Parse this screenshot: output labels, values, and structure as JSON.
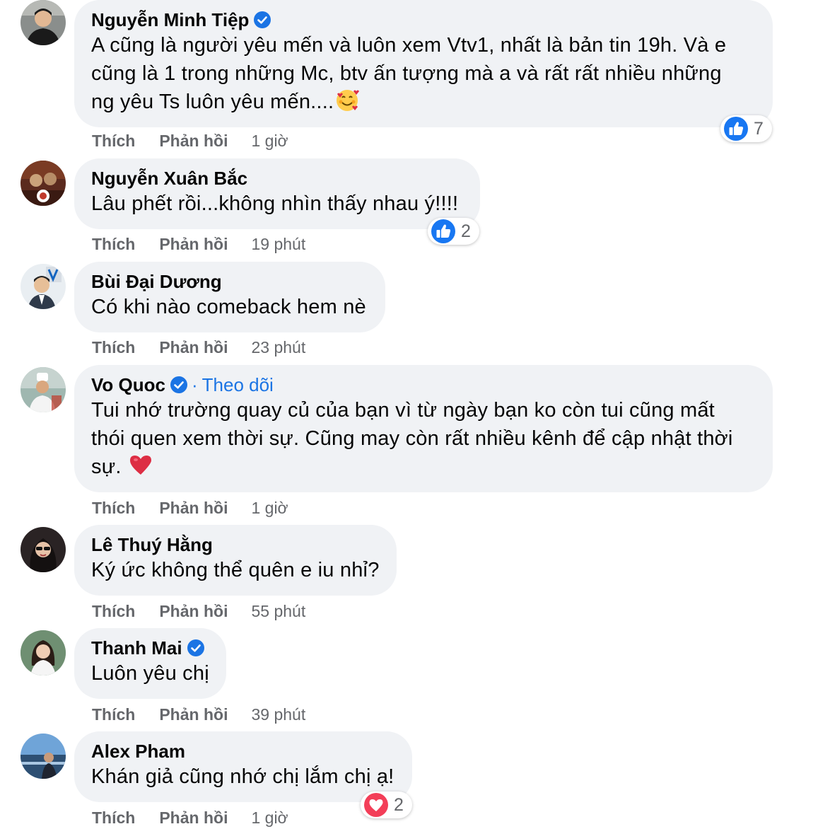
{
  "actions": {
    "like": "Thích",
    "reply": "Phản hồi"
  },
  "comments": [
    {
      "name": "Nguyễn Minh Tiệp",
      "verified": true,
      "text_lines": [
        "A cũng là người yêu mến và luôn xem Vtv1, nhất là bản tin 19h. Và e",
        "cũng là 1 trong những Mc, btv ấn tượng mà a và rất rất nhiều những",
        "ng yêu Ts luôn yêu mến...."
      ],
      "emoji": "smiling-face-with-hearts-icon",
      "time": "1 giờ",
      "reaction": {
        "type": "like",
        "count": "7"
      }
    },
    {
      "name": "Nguyễn Xuân Bắc",
      "verified": false,
      "text_lines": [
        "Lâu phết rồi...không nhìn thấy nhau ý!!!!"
      ],
      "time": "19 phút",
      "reaction": {
        "type": "like",
        "count": "2"
      }
    },
    {
      "name": "Bùi Đại Dương",
      "verified": false,
      "text_lines": [
        "Có khi nào comeback hem nè"
      ],
      "time": "23 phút"
    },
    {
      "name": "Vo Quoc",
      "verified": true,
      "follow": "Theo dõi",
      "text_lines": [
        "Tui nhớ trường quay củ của bạn vì từ ngày bạn ko còn tui cũng mất",
        "thói quen xem thời sự. Cũng may còn rất nhiều kênh để cập nhật thời",
        "sự."
      ],
      "emoji": "red-heart-icon",
      "time": "1 giờ"
    },
    {
      "name": "Lê Thuý Hằng",
      "verified": false,
      "text_lines": [
        "Ký ức không thể quên e iu nhỉ?"
      ],
      "time": "55 phút"
    },
    {
      "name": "Thanh Mai",
      "verified": true,
      "text_lines": [
        "Luôn yêu chị"
      ],
      "time": "39 phút"
    },
    {
      "name": "Alex Pham",
      "verified": false,
      "text_lines": [
        "Khán giả cũng nhớ chị lắm chị ạ!"
      ],
      "time": "1 giờ",
      "reaction": {
        "type": "love",
        "count": "2"
      }
    }
  ],
  "colors": {
    "bubble": "#f0f2f5",
    "link": "#1b74e4",
    "meta": "#65676b",
    "like": "#1877f2",
    "love": "#f33e58"
  }
}
